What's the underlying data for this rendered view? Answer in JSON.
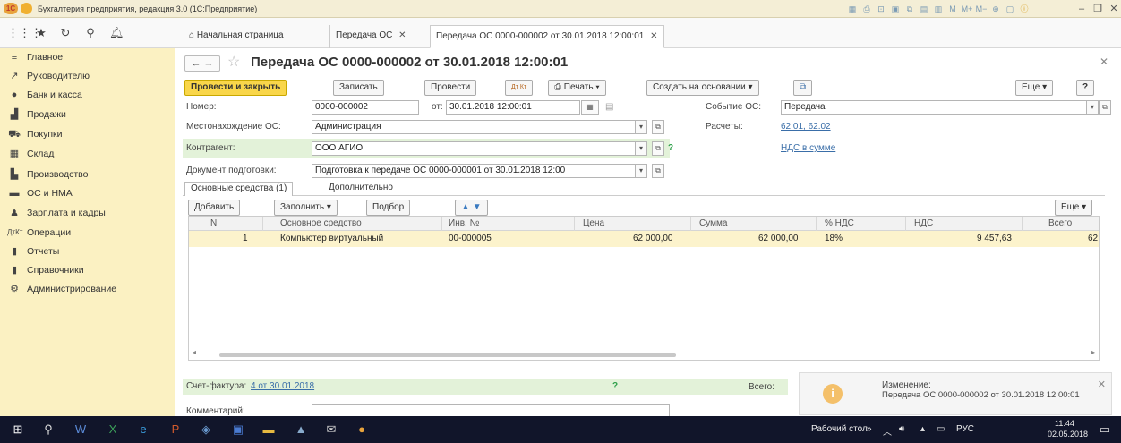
{
  "window": {
    "title": "Бухгалтерия предприятия, редакция 3.0 (1С:Предприятие)",
    "logo_text": "1С"
  },
  "tabs": [
    {
      "label": "Начальная страница"
    },
    {
      "label": "Передача ОС"
    },
    {
      "label": "Передача ОС 0000-000002 от 30.01.2018 12:00:01"
    }
  ],
  "sidebar": {
    "items": [
      {
        "label": "Главное",
        "icon": "menu-icon"
      },
      {
        "label": "Руководителю",
        "icon": "chart-trend-icon"
      },
      {
        "label": "Банк и касса",
        "icon": "bank-icon"
      },
      {
        "label": "Продажи",
        "icon": "sales-icon"
      },
      {
        "label": "Покупки",
        "icon": "cart-icon"
      },
      {
        "label": "Склад",
        "icon": "warehouse-icon"
      },
      {
        "label": "Производство",
        "icon": "factory-icon"
      },
      {
        "label": "ОС и НМА",
        "icon": "truck-icon"
      },
      {
        "label": "Зарплата и кадры",
        "icon": "person-icon"
      },
      {
        "label": "Операции",
        "icon": "operations-icon"
      },
      {
        "label": "Отчеты",
        "icon": "bar-chart-icon"
      },
      {
        "label": "Справочники",
        "icon": "book-icon"
      },
      {
        "label": "Администрирование",
        "icon": "gear-icon"
      }
    ]
  },
  "doc": {
    "title": "Передача ОС 0000-000002 от 30.01.2018 12:00:01",
    "buttons": {
      "post_close": "Провести и закрыть",
      "save": "Записать",
      "post": "Провести",
      "dt_kt": "Дт Кт",
      "print": "Печать",
      "create_based": "Создать на основании",
      "more": "Еще",
      "help": "?"
    },
    "fields": {
      "number_label": "Номер:",
      "number_value": "0000-000002",
      "date_label": "от:",
      "date_value": "30.01.2018 12:00:01",
      "location_label": "Местонахождение ОС:",
      "location_value": "Администрация",
      "counterparty_label": "Контрагент:",
      "counterparty_value": "ООО АГИО",
      "prep_doc_label": "Документ подготовки:",
      "prep_doc_value": "Подготовка к передаче ОС 0000-000001 от 30.01.2018 12:00",
      "event_label": "Событие ОС:",
      "event_value": "Передача",
      "settlements_label": "Расчеты:",
      "settlements_value": "62.01, 62.02",
      "vat_link": "НДС в сумме",
      "help_q": "?"
    },
    "subtabs": [
      "Основные средства (1)",
      "Дополнительно"
    ],
    "table_toolbar": {
      "add": "Добавить",
      "fill": "Заполнить",
      "select": "Подбор",
      "more": "Еще"
    },
    "table": {
      "columns": [
        "N",
        "Основное средство",
        "Инв. №",
        "Цена",
        "Сумма",
        "% НДС",
        "НДС",
        "Всего"
      ],
      "rows": [
        [
          "1",
          "Компьютер виртуальный",
          "00-000005",
          "62 000,00",
          "62 000,00",
          "18%",
          "9 457,63",
          "62"
        ]
      ]
    },
    "footer": {
      "invoice_label": "Счет-фактура:",
      "invoice_link": "4 от 30.01.2018",
      "invoice_help": "?",
      "total_label": "Всего:",
      "comment_label": "Комментарий:"
    }
  },
  "notification": {
    "title": "Изменение:",
    "text": "Передача ОС 0000-000002 от 30.01.2018 12:00:01"
  },
  "taskbar": {
    "desktop_label": "Рабочий стол",
    "lang": "РУС",
    "time": "11:44",
    "date": "02.05.2018"
  }
}
